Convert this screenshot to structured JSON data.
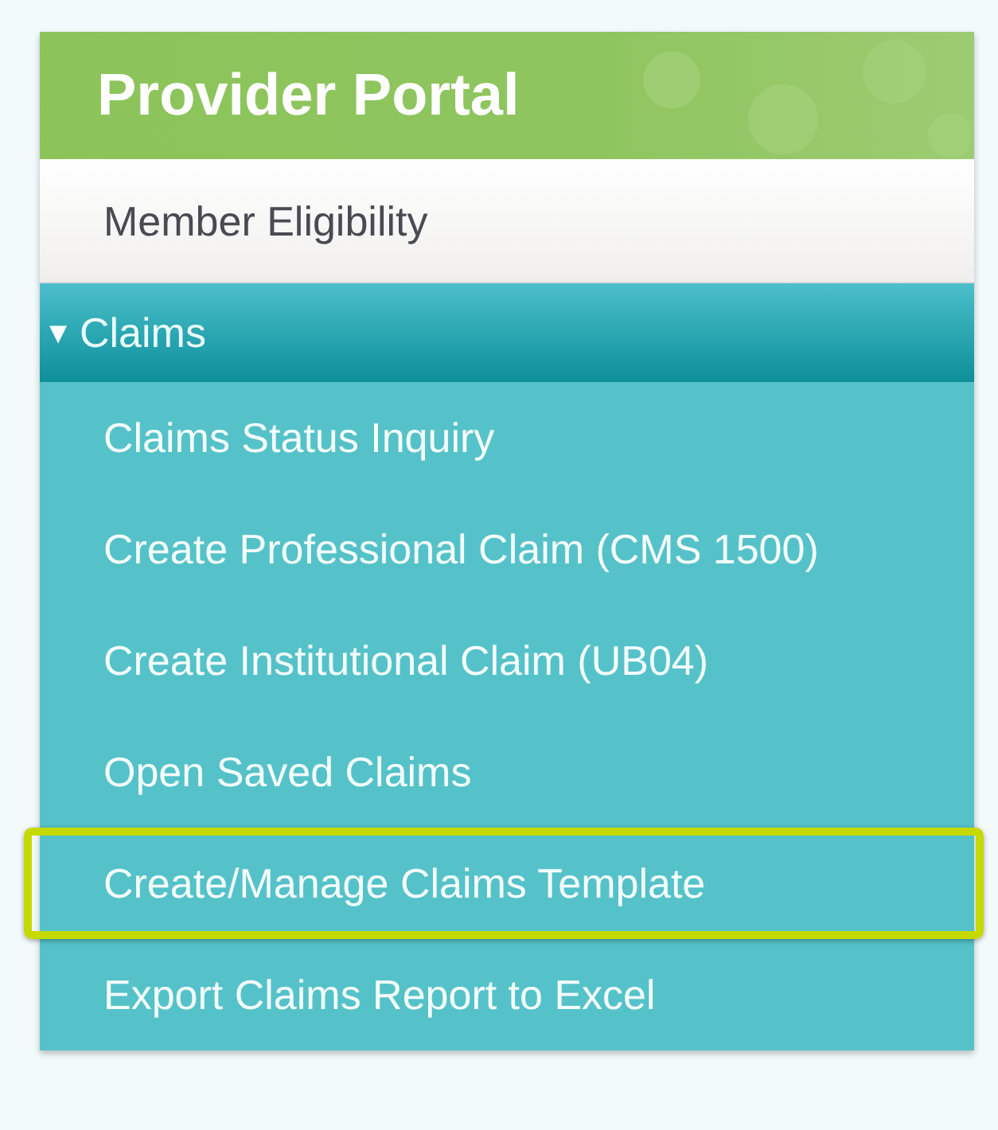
{
  "header": {
    "title": "Provider Portal"
  },
  "menu": [
    {
      "label": "Member Eligibility",
      "kind": "link"
    },
    {
      "label": "Claims",
      "kind": "section",
      "expanded": true,
      "icon": "▾",
      "children": [
        {
          "label": "Claims Status Inquiry",
          "highlighted": false
        },
        {
          "label": "Create Professional Claim (CMS 1500)",
          "highlighted": false
        },
        {
          "label": "Create Institutional Claim (UB04)",
          "highlighted": false
        },
        {
          "label": "Open Saved Claims",
          "highlighted": false
        },
        {
          "label": "Create/Manage Claims Template",
          "highlighted": true
        },
        {
          "label": "Export Claims Report to Excel",
          "highlighted": false
        }
      ]
    }
  ]
}
